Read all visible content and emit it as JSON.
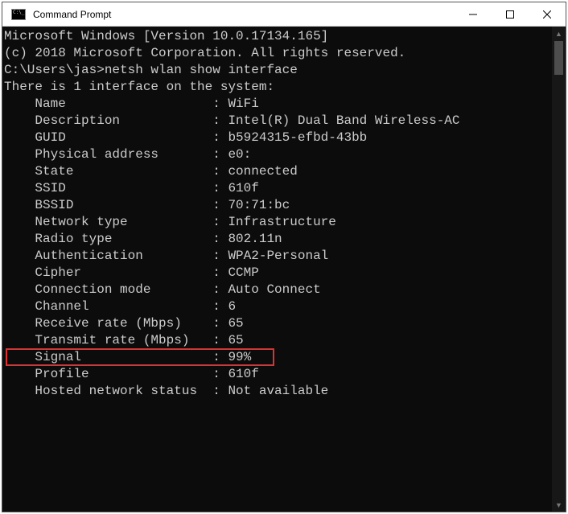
{
  "window": {
    "title": "Command Prompt"
  },
  "header": {
    "line1": "Microsoft Windows [Version 10.0.17134.165]",
    "line2": "(c) 2018 Microsoft Corporation. All rights reserved."
  },
  "prompt": {
    "path": "C:\\Users\\jas>",
    "command": "netsh wlan show interface"
  },
  "intro": "There is 1 interface on the system:",
  "fields": [
    {
      "label": "Name",
      "value": "WiFi"
    },
    {
      "label": "Description",
      "value": "Intel(R) Dual Band Wireless-AC"
    },
    {
      "label": "GUID",
      "value": "b5924315-efbd-43bb"
    },
    {
      "label": "Physical address",
      "value": "e0:"
    },
    {
      "label": "State",
      "value": "connected"
    },
    {
      "label": "SSID",
      "value": "610f"
    },
    {
      "label": "BSSID",
      "value": "70:71:bc"
    },
    {
      "label": "Network type",
      "value": "Infrastructure"
    },
    {
      "label": "Radio type",
      "value": "802.11n"
    },
    {
      "label": "Authentication",
      "value": "WPA2-Personal"
    },
    {
      "label": "Cipher",
      "value": "CCMP"
    },
    {
      "label": "Connection mode",
      "value": "Auto Connect"
    },
    {
      "label": "Channel",
      "value": "6"
    },
    {
      "label": "Receive rate (Mbps)",
      "value": "65"
    },
    {
      "label": "Transmit rate (Mbps)",
      "value": "65"
    },
    {
      "label": "Signal",
      "value": "99%",
      "highlight": true
    },
    {
      "label": "Profile",
      "value": "610f"
    }
  ],
  "footer": {
    "label": "Hosted network status",
    "value": "Not available"
  }
}
